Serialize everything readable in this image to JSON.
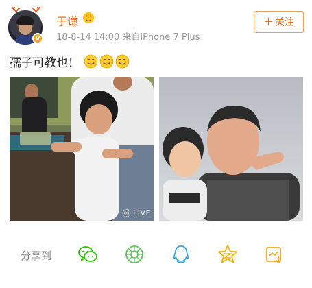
{
  "post": {
    "username": "于谦",
    "timestamp": "18-8-14 14:00",
    "source": "来自iPhone 7 Plus",
    "follow_label": "关注",
    "text": "孺子可教也！",
    "live_label": "LIVE"
  },
  "share": {
    "label": "分享到",
    "targets": [
      "wechat-icon",
      "moments-icon",
      "qq-icon",
      "qzone-icon",
      "save-icon"
    ]
  },
  "colors": {
    "username": "#f06b1d",
    "follow_border": "#f39b57",
    "share_wechat": "#2dc100",
    "share_moments": "#5fc85f",
    "share_qq": "#2fa9e0",
    "share_qzone": "#f7b500",
    "share_save": "#f7a51e"
  }
}
